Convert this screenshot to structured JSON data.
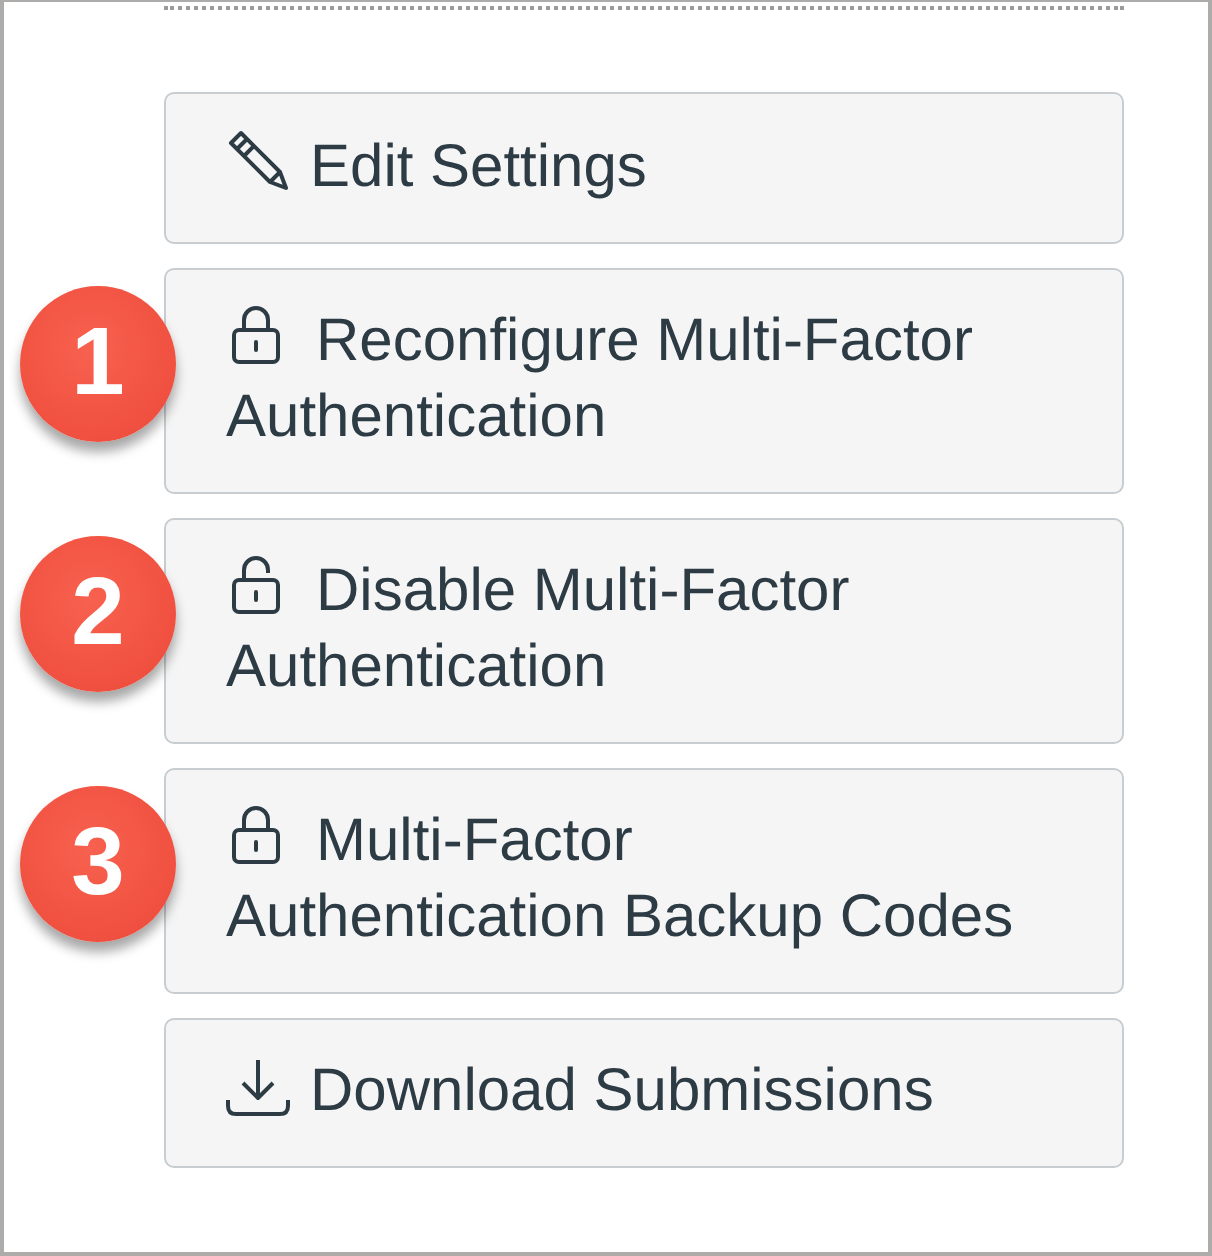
{
  "panel": {
    "buttons": [
      {
        "kind": "edit",
        "label": "Edit Settings"
      },
      {
        "kind": "lock",
        "label": "Reconfigure Multi-Factor Authentication",
        "badge": "1"
      },
      {
        "kind": "unlock",
        "label": "Disable Multi-Factor Authentication",
        "badge": "2"
      },
      {
        "kind": "lock",
        "label": "Multi-Factor Authentication Backup Codes",
        "badge": "3"
      },
      {
        "kind": "download",
        "label": "Download Submissions"
      }
    ]
  }
}
